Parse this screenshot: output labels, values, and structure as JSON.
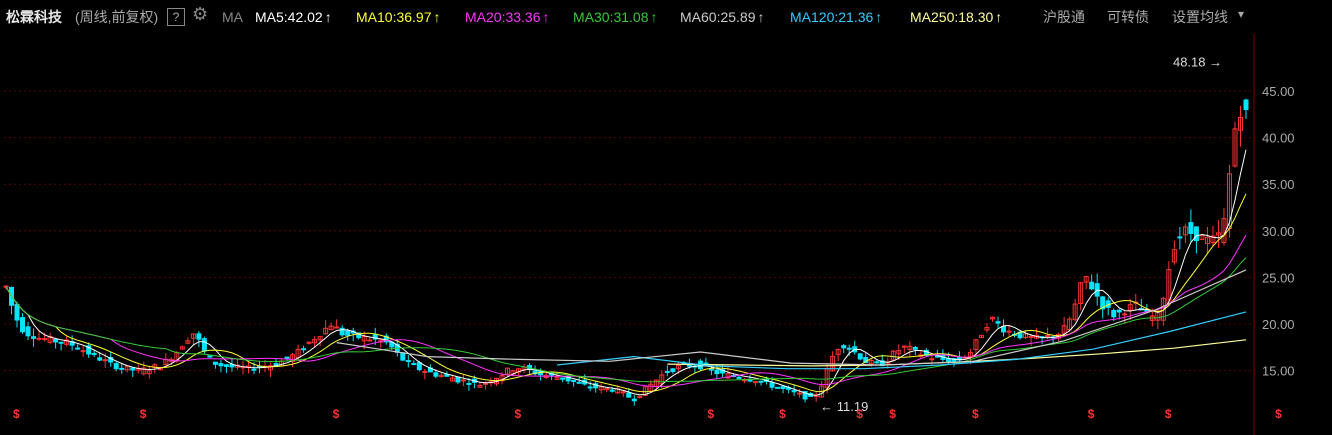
{
  "header": {
    "stock_name": "松霖科技",
    "period": "(周线,前复权)",
    "help": "?",
    "gear_icon": "gear-icon",
    "ma_label": "MA",
    "ma_items": [
      {
        "label": "MA5:42.02",
        "color": "#ffffff"
      },
      {
        "label": "MA10:36.97",
        "color": "#ffff33"
      },
      {
        "label": "MA20:33.36",
        "color": "#ff33ff"
      },
      {
        "label": "MA30:31.08",
        "color": "#33cc33"
      },
      {
        "label": "MA60:25.89",
        "color": "#cccccc"
      },
      {
        "label": "MA120:21.36",
        "color": "#33ccff"
      },
      {
        "label": "MA250:18.30",
        "color": "#ffff99"
      }
    ],
    "arrow_glyph": "↑",
    "right_buttons": [
      "沪股通",
      "可转债",
      "设置均线"
    ],
    "dropdown_icon": "chevron-down-icon"
  },
  "chart_data": {
    "type": "candlestick",
    "y_ticks": [
      "45.00",
      "40.00",
      "35.00",
      "30.00",
      "25.00",
      "20.00",
      "15.00"
    ],
    "ylim": [
      10,
      50
    ],
    "annotations": {
      "high": "48.18",
      "low": "11.19",
      "high_arrow": "→",
      "low_arrow": "←"
    },
    "dividend_marker": "$",
    "dividend_weeks": [
      2,
      25,
      60,
      93,
      128,
      141,
      155,
      161,
      176,
      197,
      211,
      231
    ],
    "colors": {
      "up": "#ff3232",
      "down": "#00e5ff",
      "grid": "#5a0000"
    },
    "close": [
      24,
      22,
      20.5,
      19.5,
      19,
      18.8,
      18.5,
      18.4,
      18.3,
      18.2,
      18.1,
      18,
      17.8,
      17.5,
      17.2,
      16.9,
      16.6,
      16.3,
      16,
      15.7,
      15.5,
      15.3,
      15.2,
      15.1,
      15,
      15.1,
      15.2,
      15.4,
      15.6,
      16,
      16.5,
      17,
      17.8,
      18.5,
      19,
      18.2,
      17,
      16.2,
      15.8,
      15.6,
      15.5,
      15.4,
      15.3,
      15.3,
      15.2,
      15.3,
      15.4,
      15.5,
      15.6,
      15.8,
      16,
      16.3,
      16.6,
      17,
      17.5,
      18,
      18.5,
      19,
      19.5,
      20,
      19.5,
      19,
      18.8,
      18.7,
      18.6,
      18.5,
      18.4,
      18.3,
      18.2,
      18,
      17.5,
      16.8,
      16.2,
      15.8,
      15.5,
      15.2,
      15,
      14.8,
      14.6,
      14.5,
      14.3,
      14.2,
      14,
      13.9,
      13.8,
      13.6,
      13.5,
      13.7,
      14,
      14.3,
      14.6,
      15,
      15.2,
      15.3,
      15.2,
      15,
      14.8,
      14.6,
      14.5,
      14.4,
      14.3,
      14.2,
      14,
      13.8,
      13.6,
      13.4,
      13.3,
      13.2,
      13.1,
      13,
      13,
      12.8,
      12.5,
      12.2,
      12,
      12.5,
      13,
      13.5,
      14,
      14.5,
      15,
      15.2,
      15.4,
      15.5,
      15.6,
      15.6,
      15.5,
      15.3,
      15,
      14.8,
      14.6,
      14.5,
      14.4,
      14.3,
      14.2,
      14.1,
      14,
      13.8,
      13.6,
      13.4,
      13.2,
      13,
      12.8,
      12.6,
      12.4,
      12.2,
      12,
      12.5,
      13.5,
      15,
      16.5,
      17.5,
      17.8,
      17.5,
      17,
      16.5,
      16,
      15.8,
      15.6,
      15.8,
      16.2,
      16.8,
      17.2,
      17.5,
      17.3,
      17,
      16.8,
      16.6,
      16.4,
      16.3,
      16.2,
      16.1,
      16,
      16.2,
      16.5,
      17,
      18,
      19,
      20,
      20.5,
      20,
      19.5,
      19.2,
      19,
      18.8,
      18.6,
      18.5,
      18.4,
      18.5,
      18.6,
      18.8,
      19,
      19.5,
      20.5,
      22,
      24,
      25,
      24,
      23,
      22,
      21.5,
      21,
      21.2,
      21.5,
      21.8,
      22,
      21.5,
      21,
      20.8,
      21,
      23,
      26,
      28.5,
      29.5,
      30,
      29.8,
      29.5,
      29.2,
      29,
      29,
      29.5,
      31,
      36,
      41,
      43,
      42.5
    ],
    "ma_series": [
      {
        "name": "MA250",
        "color": "#ffff99",
        "values": [
          15.7,
          15.6,
          15.5,
          15.6,
          15.9,
          16.3,
          16.8,
          17.4,
          18.3
        ]
      },
      {
        "name": "MA120",
        "color": "#33ccff",
        "values": [
          15.6,
          16.5,
          15.5,
          15.2,
          15.2,
          15.6,
          16.2,
          17.3,
          19.2,
          21.3
        ]
      },
      {
        "name": "MA60",
        "color": "#cccccc",
        "values": [
          18,
          16.5,
          16.2,
          16,
          17,
          15.8,
          15.6,
          16,
          18.2,
          21.5,
          25.8
        ]
      }
    ]
  }
}
